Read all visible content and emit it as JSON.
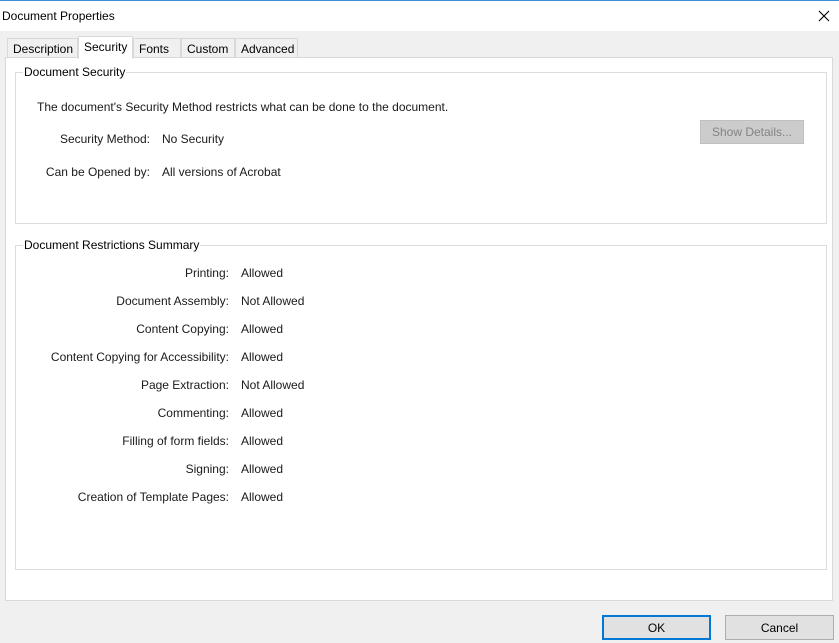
{
  "window": {
    "title": "Document Properties",
    "close_icon": "close-icon"
  },
  "tabs": [
    {
      "label": "Description"
    },
    {
      "label": "Security",
      "active": true
    },
    {
      "label": "Fonts"
    },
    {
      "label": "Custom"
    },
    {
      "label": "Advanced"
    }
  ],
  "document_security": {
    "title": "Document Security",
    "intro": "The document's Security Method restricts what can be done to the document.",
    "method_label": "Security Method:",
    "method_value": "No Security",
    "opened_label": "Can be Opened by:",
    "opened_value": "All versions of Acrobat",
    "show_details_label": "Show Details..."
  },
  "restrictions": {
    "title": "Document Restrictions Summary",
    "rows": [
      {
        "label": "Printing:",
        "value": "Allowed"
      },
      {
        "label": "Document Assembly:",
        "value": "Not Allowed"
      },
      {
        "label": "Content Copying:",
        "value": "Allowed"
      },
      {
        "label": "Content Copying for Accessibility:",
        "value": "Allowed"
      },
      {
        "label": "Page Extraction:",
        "value": "Not Allowed"
      },
      {
        "label": "Commenting:",
        "value": "Allowed"
      },
      {
        "label": "Filling of form fields:",
        "value": "Allowed"
      },
      {
        "label": "Signing:",
        "value": "Allowed"
      },
      {
        "label": "Creation of Template Pages:",
        "value": "Allowed"
      }
    ]
  },
  "footer": {
    "ok_label": "OK",
    "cancel_label": "Cancel"
  },
  "colors": {
    "accent": "#0078d7",
    "panel_bg": "#ffffff",
    "dialog_bg": "#f0f0f0"
  }
}
